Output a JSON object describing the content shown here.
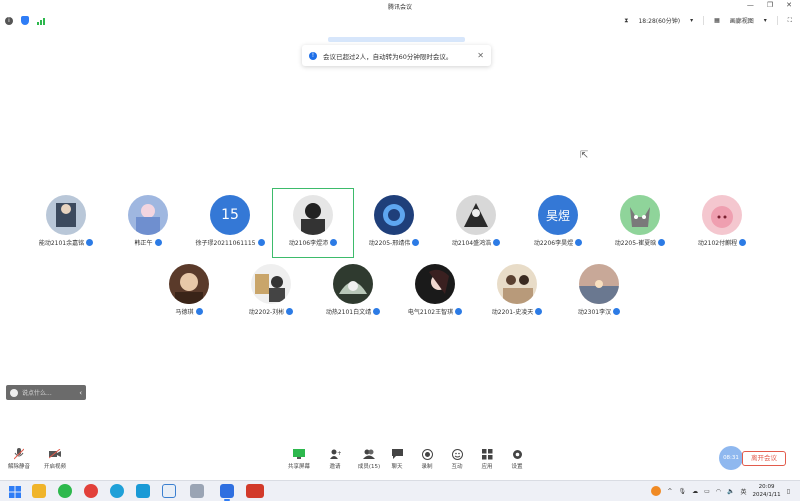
{
  "window": {
    "title": "腾讯会议"
  },
  "infobar": {
    "time": "18:28(60分钟)",
    "view": "画廊视图"
  },
  "toast": {
    "text": "会议已超过2人，自动转为60分钟限时会议。"
  },
  "participants": [
    {
      "name": "能动2101余嘉铭"
    },
    {
      "name": "韩正午"
    },
    {
      "name": "徐子璆20211061115",
      "initial": "15"
    },
    {
      "name": "动2106李煜沛"
    },
    {
      "name": "动2205-邢靖伟"
    },
    {
      "name": "动2104盛鸿浩"
    },
    {
      "name": "动2206李昊煜",
      "initial": "昊煜"
    },
    {
      "name": "动2205-崔夏晗"
    },
    {
      "name": "动2102付麒程"
    },
    {
      "name": "马德琪"
    },
    {
      "name": "动2202-刘彬"
    },
    {
      "name": "动热2101白文靖"
    },
    {
      "name": "电气2102王智琪"
    },
    {
      "name": "动2201-史凌天"
    },
    {
      "name": "动2301李汉"
    }
  ],
  "chat": {
    "placeholder": "说点什么..."
  },
  "toolbar": {
    "unmute": "解除静音",
    "video": "开启视频",
    "share": "共享屏幕",
    "invite": "邀请",
    "members": "成员(15)",
    "chat": "聊天",
    "record": "录制",
    "reaction": "互动",
    "apps": "应用",
    "settings": "设置",
    "leave": "离开会议",
    "timer": "08:31"
  },
  "taskbar": {
    "time": "20:09",
    "date": "2024/1/11",
    "ime": "英"
  },
  "colors": {
    "accent": "#2c7be5",
    "active_border": "#3dbb6b",
    "leave": "#e25b4c"
  }
}
